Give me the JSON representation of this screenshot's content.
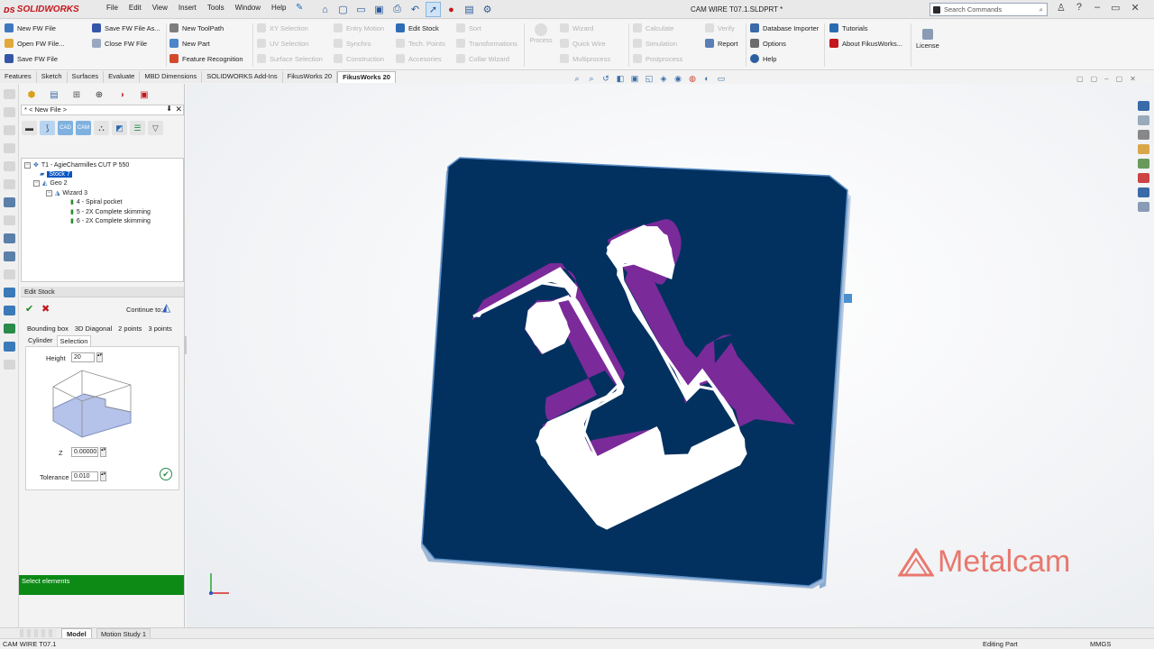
{
  "app": {
    "name": "SOLIDWORKS",
    "doc_title": "CAM WIRE T07.1.SLDPRT *"
  },
  "menu": [
    "File",
    "Edit",
    "View",
    "Insert",
    "Tools",
    "Window",
    "Help"
  ],
  "search": {
    "placeholder": "Search Commands"
  },
  "ribbon": {
    "col1": [
      "New FW File",
      "Open FW File...",
      "Save FW File"
    ],
    "col2": [
      "Save FW File As...",
      "Close FW File"
    ],
    "col3": [
      "New ToolPath",
      "New Part",
      "Feature Recognition"
    ],
    "col4": [
      "XY Selection",
      "UV Selection",
      "Surface Selection"
    ],
    "col5": [
      "Entry Motion",
      "Synchro",
      "Construction"
    ],
    "col6": [
      "Edit Stock",
      "Tech. Points",
      "Accesories"
    ],
    "col7": [
      "Sort",
      "Transformations",
      "Collar Wizard"
    ],
    "process": "Process",
    "col8": [
      "Wizard",
      "Quick Wire",
      "Multiprocess"
    ],
    "col9": [
      "Calculate",
      "Simulation",
      "Postprocess"
    ],
    "col10": [
      "Verify",
      "Report"
    ],
    "col11": [
      "Database Importer",
      "Options",
      "Help"
    ],
    "col12": [
      "Tutorials",
      "About FikusWorks..."
    ],
    "license": "License"
  },
  "tabs": [
    "Features",
    "Sketch",
    "Surfaces",
    "Evaluate",
    "MBD Dimensions",
    "SOLIDWORKS Add-Ins",
    "FikusWorks 20",
    "FikusWorks 20"
  ],
  "panel": {
    "crumb": "* < New File >",
    "cam_icons": [
      "CAD",
      "CAM"
    ],
    "tree": [
      {
        "label": "T1 - AgieCharmilles CUT P 550"
      },
      {
        "label": "Stock 7"
      },
      {
        "label": "Geo 2"
      },
      {
        "label": "Wizard 3"
      },
      {
        "label": "4 - Spiral pocket"
      },
      {
        "label": "5 - 2X Complete skimming"
      },
      {
        "label": "6 - 2X Complete skimming"
      }
    ],
    "edit_stock": {
      "title": "Edit Stock",
      "continue_to": "Continue to:",
      "tabs_row1": [
        "Bounding box",
        "3D Diagonal",
        "2 points",
        "3 points"
      ],
      "tabs_row2": [
        "Cylinder",
        "Selection"
      ],
      "height_label": "Height",
      "height_value": "20",
      "z_label": "Z",
      "z_value": "0.00000",
      "tolerance_label": "Tolerance",
      "tolerance_value": "0.010"
    },
    "status": "Select elements"
  },
  "bottom_tabs": [
    "Model",
    "Motion Study 1"
  ],
  "statusbar": {
    "left": "CAM WIRE T07.1",
    "mode": "Editing Part",
    "units": "MMGS"
  },
  "watermark": "Metalcam",
  "colors": {
    "part": "#03315f",
    "part_edge": "#5b8fc7",
    "slot": "#ffffff",
    "slot_edge": "#7b2a9a",
    "accent_red": "#c4161c",
    "status_green": "#0c8a15"
  }
}
